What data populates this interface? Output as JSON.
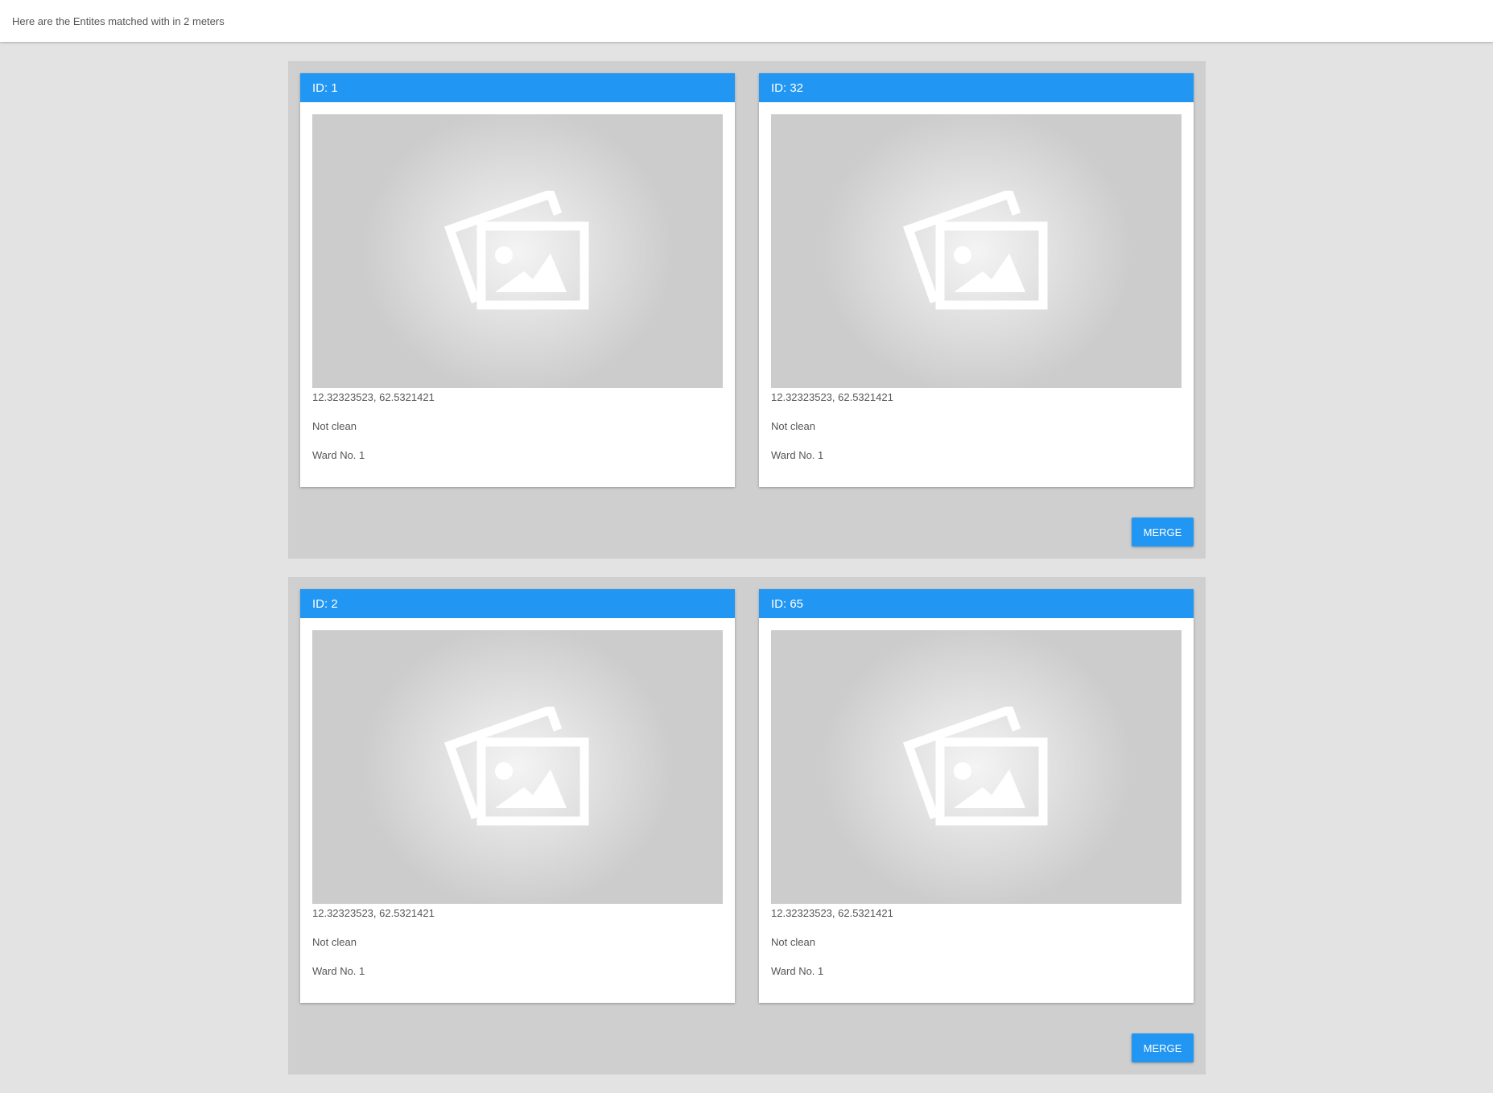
{
  "header": {
    "message": "Here are the Entites matched with in 2 meters"
  },
  "groups": [
    {
      "cards": [
        {
          "id_label": "ID: 1",
          "coords": "12.32323523, 62.5321421",
          "status": "Not clean",
          "ward": "Ward No. 1",
          "image_icon": "image-placeholder-icon"
        },
        {
          "id_label": "ID: 32",
          "coords": "12.32323523, 62.5321421",
          "status": "Not clean",
          "ward": "Ward No. 1",
          "image_icon": "image-placeholder-icon"
        }
      ],
      "merge_label": "MERGE"
    },
    {
      "cards": [
        {
          "id_label": "ID: 2",
          "coords": "12.32323523, 62.5321421",
          "status": "Not clean",
          "ward": "Ward No. 1",
          "image_icon": "image-placeholder-icon"
        },
        {
          "id_label": "ID: 65",
          "coords": "12.32323523, 62.5321421",
          "status": "Not clean",
          "ward": "Ward No. 1",
          "image_icon": "image-placeholder-icon"
        }
      ],
      "merge_label": "MERGE"
    }
  ],
  "colors": {
    "accent": "#2196f3",
    "page_background": "#e3e3e3",
    "group_background": "#cfcfcf"
  }
}
